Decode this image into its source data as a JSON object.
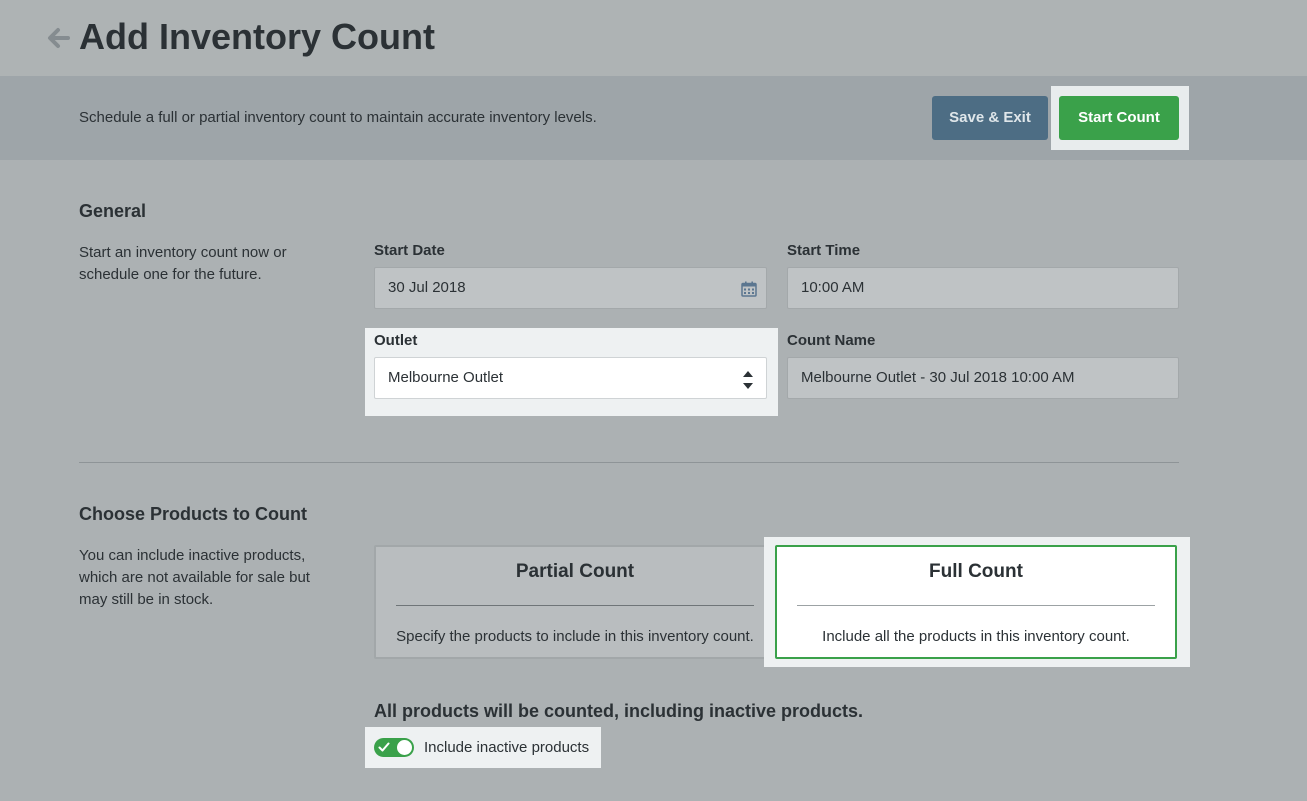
{
  "header": {
    "title": "Add Inventory Count",
    "back_icon": "arrow-left-icon"
  },
  "subheader": {
    "description": "Schedule a full or partial inventory count to maintain accurate inventory levels.",
    "save_exit_label": "Save & Exit",
    "start_count_label": "Start Count"
  },
  "general": {
    "title": "General",
    "description": "Start an inventory count now or schedule one for the future.",
    "start_date": {
      "label": "Start Date",
      "value": "30 Jul 2018",
      "icon": "calendar-icon"
    },
    "start_time": {
      "label": "Start Time",
      "value": "10:00 AM"
    },
    "outlet": {
      "label": "Outlet",
      "value": "Melbourne Outlet",
      "icon": "select-updown-icon"
    },
    "count_name": {
      "label": "Count Name",
      "value": "Melbourne Outlet - 30 Jul 2018 10:00 AM"
    }
  },
  "products": {
    "title": "Choose Products to Count",
    "description": "You can include inactive products, which are not available for sale but may still be in stock.",
    "partial": {
      "title": "Partial Count",
      "description": "Specify the products to include in this inventory count."
    },
    "full": {
      "title": "Full Count",
      "description": "Include all the products in this inventory count.",
      "selected": true
    },
    "notice": "All products will be counted, including inactive products.",
    "include_inactive": {
      "label": "Include inactive products",
      "enabled": true
    }
  },
  "colors": {
    "accent_green": "#3aa14a",
    "save_button": "#4d6d84"
  }
}
